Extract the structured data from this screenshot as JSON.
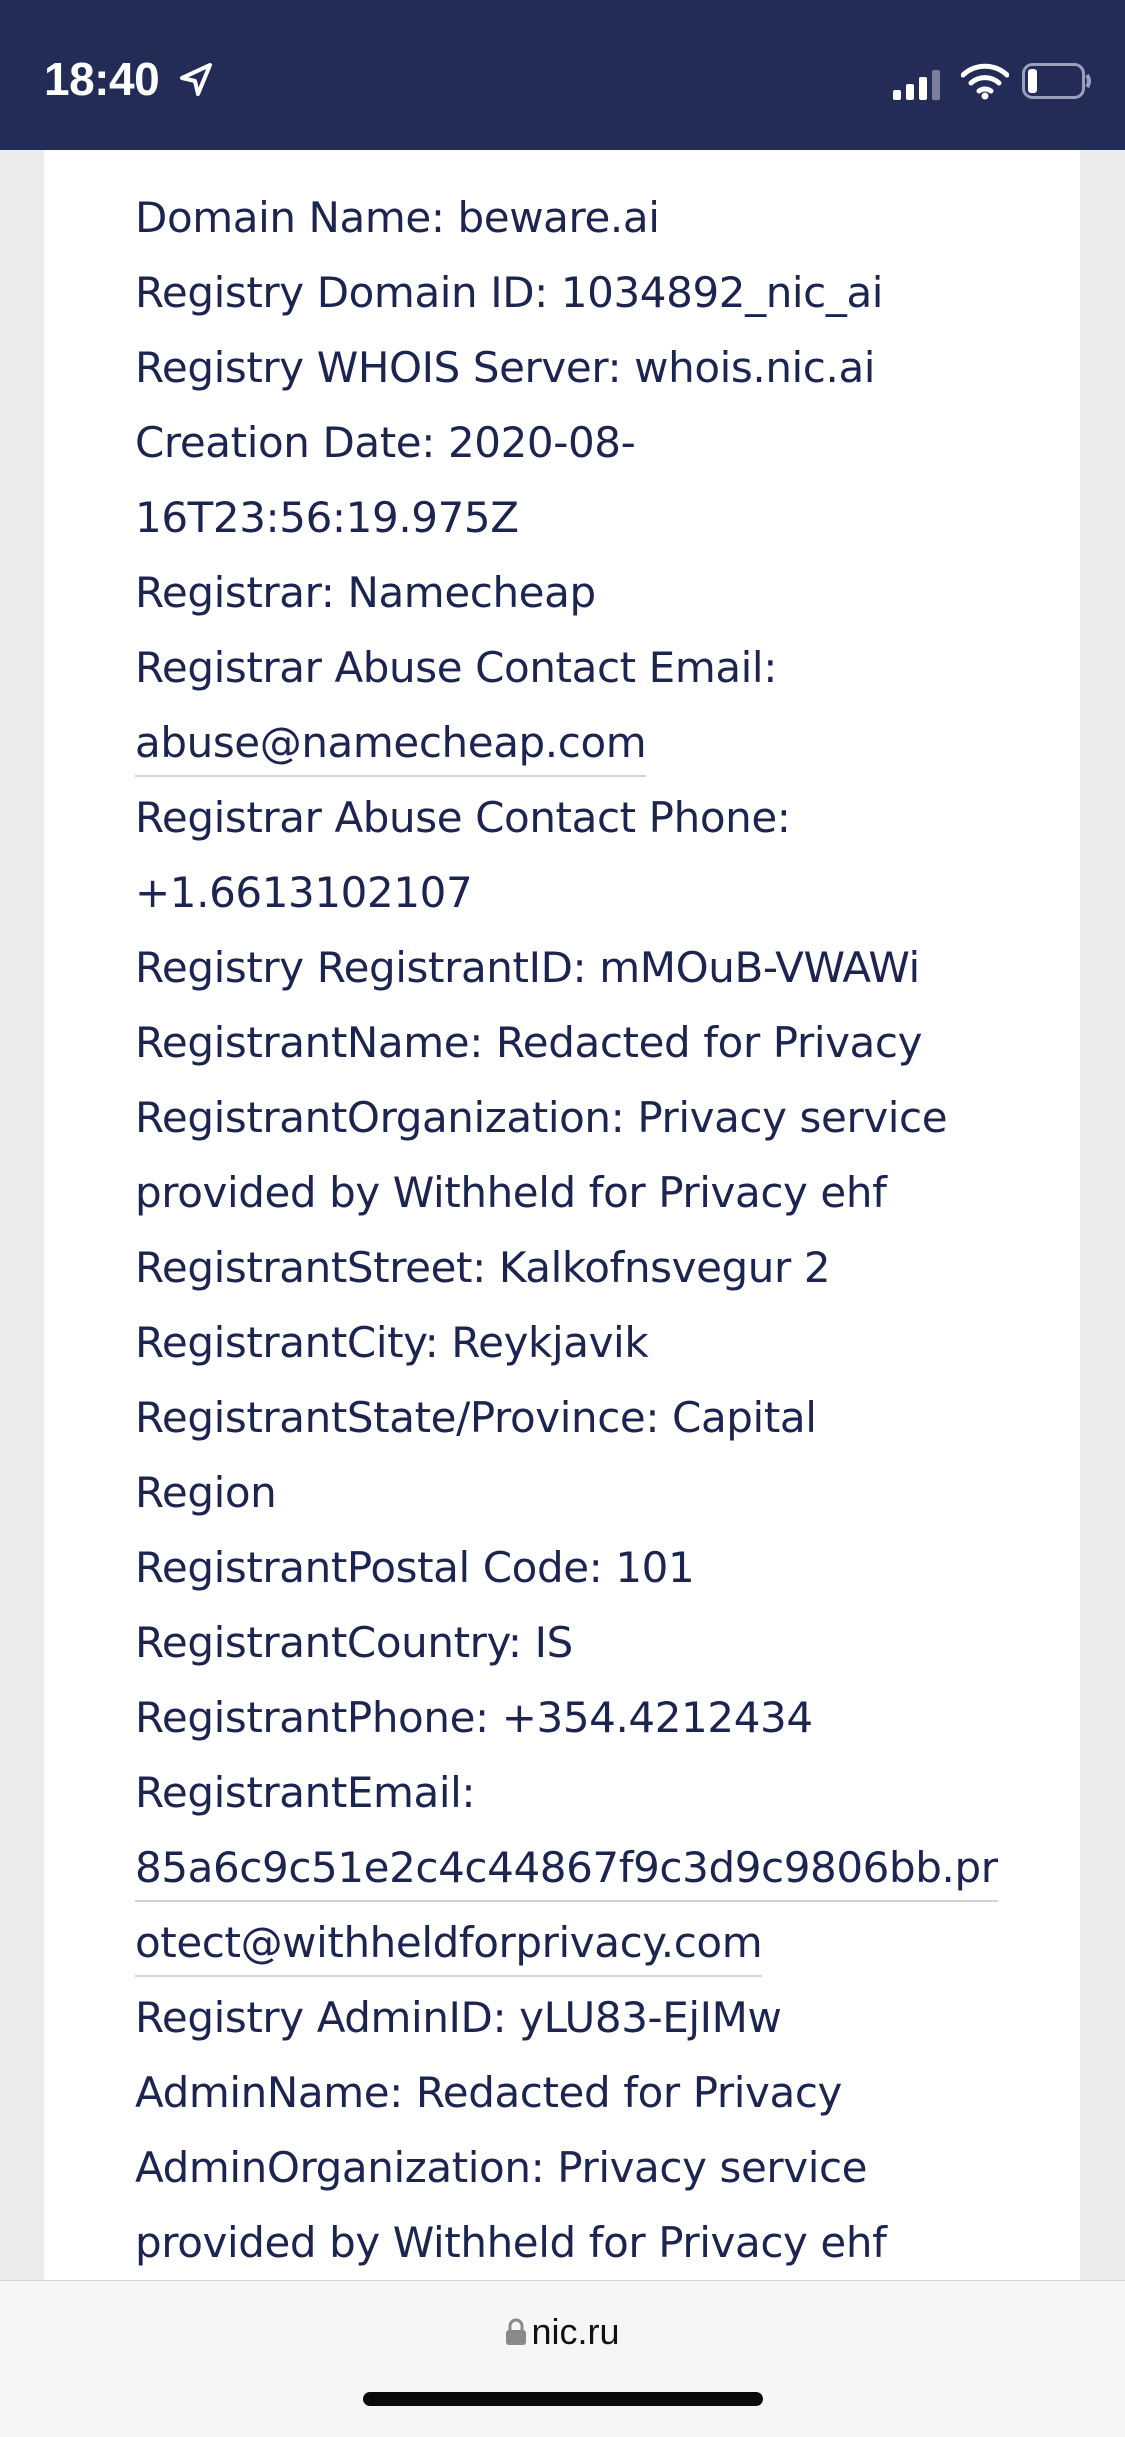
{
  "status_bar": {
    "time": "18:40",
    "icons": [
      "location-arrow-icon",
      "cellular-signal-icon",
      "wifi-icon",
      "battery-low-icon"
    ],
    "background": "#232b57"
  },
  "whois": {
    "lines": [
      {
        "text": "Domain Name: beware.ai"
      },
      {
        "text": "Registry Domain ID: 1034892_nic_ai"
      },
      {
        "text": "Registry WHOIS Server: whois.nic.ai"
      },
      {
        "text": "Creation Date: 2020-08-"
      },
      {
        "text": "16T23:56:19.975Z"
      },
      {
        "text": "Registrar: Namecheap"
      },
      {
        "text": "Registrar Abuse Contact Email:"
      },
      {
        "link": "abuse@namecheap.com"
      },
      {
        "text": "Registrar Abuse Contact Phone:"
      },
      {
        "text": "+1.6613102107"
      },
      {
        "text": "Registry RegistrantID: mMOuB-VWAWi"
      },
      {
        "text": "RegistrantName: Redacted for Privacy"
      },
      {
        "text": "RegistrantOrganization: Privacy service"
      },
      {
        "text": "provided by Withheld for Privacy ehf"
      },
      {
        "text": "RegistrantStreet: Kalkofnsvegur 2"
      },
      {
        "text": "RegistrantCity: Reykjavik"
      },
      {
        "text": "RegistrantState/Province: Capital"
      },
      {
        "text": "Region"
      },
      {
        "text": "RegistrantPostal Code: 101"
      },
      {
        "text": "RegistrantCountry: IS"
      },
      {
        "text": "RegistrantPhone: +354.4212434"
      },
      {
        "text": "RegistrantEmail:"
      },
      {
        "link": "85a6c9c51e2c4c44867f9c3d9c9806bb.pr"
      },
      {
        "link": "otect@withheldforprivacy.com"
      },
      {
        "text": "Registry AdminID: yLU83-EjIMw"
      },
      {
        "text": "AdminName: Redacted for Privacy"
      },
      {
        "text": "AdminOrganization: Privacy service"
      },
      {
        "text": "provided by Withheld for Privacy ehf"
      }
    ],
    "text_color": "#1c2450"
  },
  "url_bar": {
    "domain": "nic.ru",
    "icon": "lock-icon"
  }
}
